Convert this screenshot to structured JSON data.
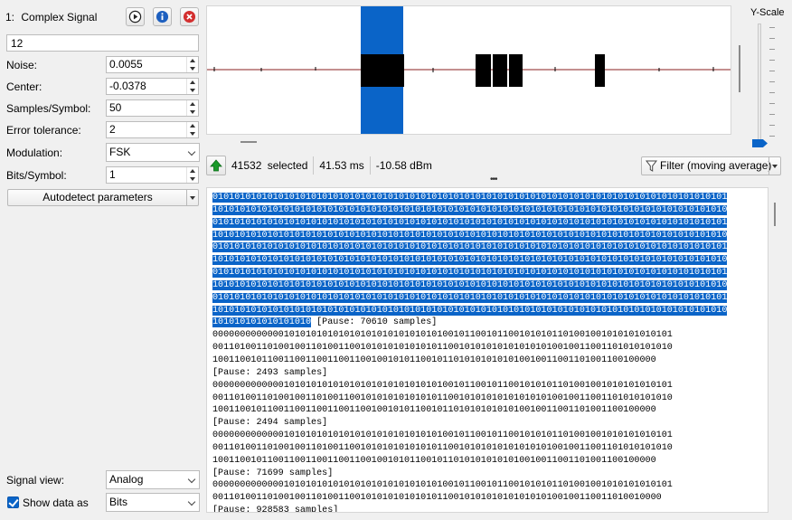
{
  "signal": {
    "number": "1:",
    "title": "Complex Signal",
    "name_value": "12"
  },
  "params": {
    "noise": {
      "label": "Noise:",
      "value": "0.0055"
    },
    "center": {
      "label": "Center:",
      "value": "-0.0378"
    },
    "samples_per_symbol": {
      "label": "Samples/Symbol:",
      "value": "50"
    },
    "error_tolerance": {
      "label": "Error tolerance:",
      "value": "2"
    },
    "modulation": {
      "label": "Modulation:",
      "value": "FSK"
    },
    "bits_per_symbol": {
      "label": "Bits/Symbol:",
      "value": "1"
    },
    "autodetect_label": "Autodetect parameters"
  },
  "bottom": {
    "signal_view_label": "Signal view:",
    "signal_view_value": "Analog",
    "show_data_label": "Show data as",
    "show_data_checked": true,
    "show_data_value": "Bits"
  },
  "graph": {
    "yscale_label": "Y-Scale",
    "selection_color": "#0a64c8",
    "baseline_color": "#b06a6a"
  },
  "status": {
    "selected_count": "41532",
    "selected_word": "selected",
    "duration": "41.53 ms",
    "power": "-10.58 dBm",
    "filter_label": "Filter (moving average)"
  },
  "icons": {
    "play": "play-icon",
    "info": "info-icon",
    "close": "close-icon",
    "arrow_up": "arrow-up-icon",
    "filter": "filter-icon"
  },
  "data_lines": [
    {
      "sel": "0101010101010101010101010101010101010101010101010101010101010101010101010101010101010101010101",
      "rest": ""
    },
    {
      "sel": "1010101010101010101010101010101010101010101010101010101010101010101010101010101010101010101010",
      "rest": ""
    },
    {
      "sel": "0101010101010101010101010101010101010101010101010101010101010101010101010101010101010101010101",
      "rest": ""
    },
    {
      "sel": "1010101010101010101010101010101010101010101010101010101010101010101010101010101010101010101010",
      "rest": ""
    },
    {
      "sel": "0101010101010101010101010101010101010101010101010101010101010101010101010101010101010101010101",
      "rest": ""
    },
    {
      "sel": "1010101010101010101010101010101010101010101010101010101010101010101010101010101010101010101010",
      "rest": ""
    },
    {
      "sel": "0101010101010101010101010101010101010101010101010101010101010101010101010101010101010101010101",
      "rest": ""
    },
    {
      "sel": "1010101010101010101010101010101010101010101010101010101010101010101010101010101010101010101010",
      "rest": ""
    },
    {
      "sel": "0101010101010101010101010101010101010101010101010101010101010101010101010101010101010101010101",
      "rest": ""
    },
    {
      "sel": "1010101010101010101010101010101010101010101010101010101010101010101010101010101010101010101010",
      "rest": ""
    },
    {
      "sel": "101010101010101010",
      "rest": " [Pause: 70610 samples]"
    },
    {
      "sel": "",
      "rest": "000000000000010101010101010101010101010101001011001011001010101101001001010101010101"
    },
    {
      "sel": "",
      "rest": "001101001101001001101001100101010101010101100101010101010101010010011001101010101010"
    },
    {
      "sel": "",
      "rest": "100110010110011001100110011001001010110010110101010101010010011001101001100100000"
    },
    {
      "sel": "",
      "rest": "[Pause: 2493 samples]"
    },
    {
      "sel": "",
      "rest": "000000000000010101010101010101010101010101001011001011001010101101001001010101010101"
    },
    {
      "sel": "",
      "rest": "001101001101001001101001100101010101010101100101010101010101010010011001101010101010"
    },
    {
      "sel": "",
      "rest": "100110010110011001100110011001001010110010110101010101010010011001101001100100000"
    },
    {
      "sel": "",
      "rest": "[Pause: 2494 samples]"
    },
    {
      "sel": "",
      "rest": "000000000000010101010101010101010101010101001011001011001010101101001001010101010101"
    },
    {
      "sel": "",
      "rest": "001101001101001001101001100101010101010101100101010101010101010010011001101010101010"
    },
    {
      "sel": "",
      "rest": "100110010110011001100110011001001010110010110101010101010010011001101001100100000"
    },
    {
      "sel": "",
      "rest": "[Pause: 71699 samples]"
    },
    {
      "sel": "",
      "rest": "000000000000010101010101010101010101010101001011001011001010101101001001010101010101"
    },
    {
      "sel": "",
      "rest": "0011010011010010011010011001010101010101011001010101010101010100100110011010010000"
    },
    {
      "sel": "",
      "rest": "[Pause: 928583 samples]"
    }
  ]
}
